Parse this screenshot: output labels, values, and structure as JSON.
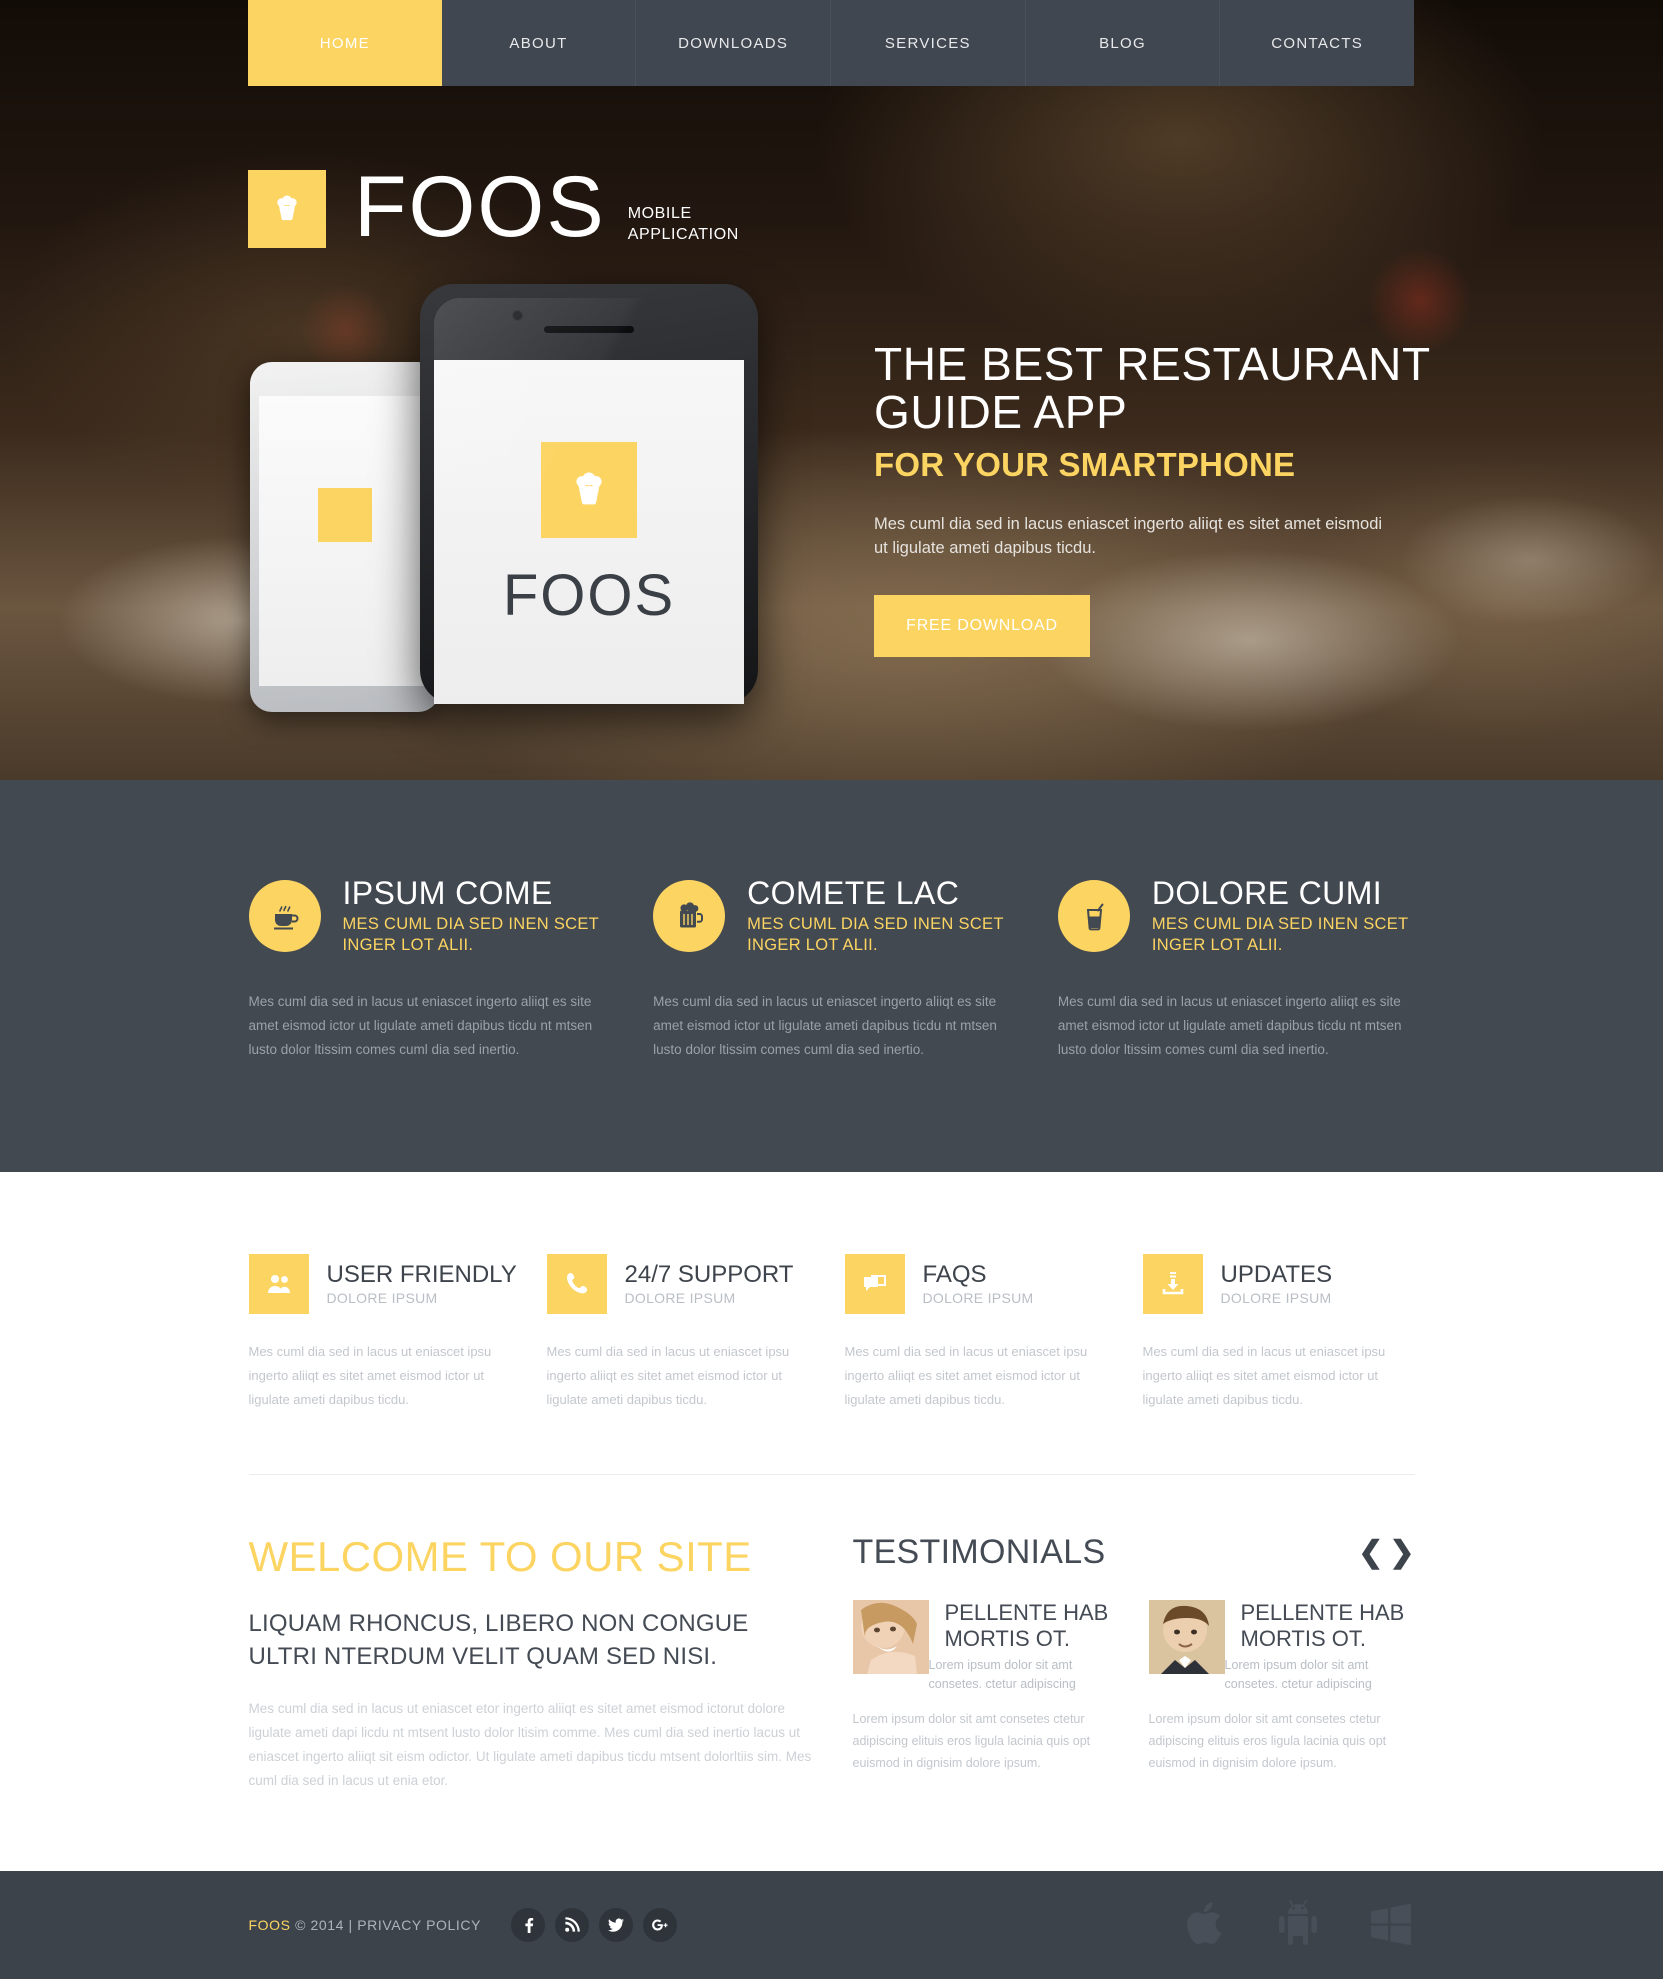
{
  "nav": {
    "items": [
      {
        "label": "HOME",
        "active": true
      },
      {
        "label": "ABOUT",
        "active": false
      },
      {
        "label": "DOWNLOADS",
        "active": false
      },
      {
        "label": "SERVICES",
        "active": false
      },
      {
        "label": "BLOG",
        "active": false
      },
      {
        "label": "CONTACTS",
        "active": false
      }
    ]
  },
  "logo": {
    "name": "FOOS",
    "tagline_line1": "MOBILE",
    "tagline_line2": "APPLICATION",
    "icon": "cupcake-icon"
  },
  "hero": {
    "heading": "THE BEST RESTAURANT GUIDE APP",
    "subheading": "FOR YOUR SMARTPHONE",
    "paragraph": "Mes cuml dia sed in lacus eniascet ingerto aliiqt es sitet amet eismodi ut ligulate ameti dapibus ticdu.",
    "button_label": "FREE DOWNLOAD",
    "phone_screen_word": "FOOS"
  },
  "features": [
    {
      "icon": "coffee-cup-icon",
      "title": "IPSUM COME",
      "subtitle": "MES CUML DIA SED INEN SCET INGER LOT ALII.",
      "body": "Mes cuml dia sed in lacus ut eniascet ingerto aliiqt es site amet eismod ictor ut ligulate ameti dapibus ticdu nt mtsen lusto dolor ltissim comes cuml dia sed inertio."
    },
    {
      "icon": "beer-mug-icon",
      "title": "COMETE LAC",
      "subtitle": "MES CUML DIA SED INEN SCET INGER LOT ALII.",
      "body": "Mes cuml dia sed in lacus ut eniascet ingerto aliiqt es site amet eismod ictor ut ligulate ameti dapibus ticdu nt mtsen lusto dolor ltissim comes cuml dia sed inertio."
    },
    {
      "icon": "drink-glass-icon",
      "title": "DOLORE CUMI",
      "subtitle": "MES CUML DIA SED INEN SCET INGER LOT ALII.",
      "body": "Mes cuml dia sed in lacus ut eniascet ingerto aliiqt es site amet eismod ictor ut ligulate ameti dapibus ticdu nt mtsen lusto dolor ltissim comes cuml dia sed inertio."
    }
  ],
  "services": [
    {
      "icon": "users-icon",
      "title": "USER FRIENDLY",
      "subtitle": "DOLORE IPSUM",
      "body": "Mes cuml dia sed in lacus ut eniascet ipsu ingerto aliiqt es sitet amet eismod ictor ut ligulate ameti dapibus ticdu."
    },
    {
      "icon": "phone-icon",
      "title": "24/7 SUPPORT",
      "subtitle": "DOLORE IPSUM",
      "body": "Mes cuml dia sed in lacus ut eniascet ipsu ingerto aliiqt es sitet amet eismod ictor ut ligulate ameti dapibus ticdu."
    },
    {
      "icon": "chat-bubbles-icon",
      "title": "FAQS",
      "subtitle": "DOLORE IPSUM",
      "body": "Mes cuml dia sed in lacus ut eniascet ipsu ingerto aliiqt es sitet amet eismod ictor ut ligulate ameti dapibus ticdu."
    },
    {
      "icon": "download-tray-icon",
      "title": "UPDATES",
      "subtitle": "DOLORE IPSUM",
      "body": "Mes cuml dia sed in lacus ut eniascet ipsu ingerto aliiqt es sitet amet eismod ictor ut ligulate ameti dapibus ticdu."
    }
  ],
  "welcome": {
    "heading": "WELCOME TO OUR SITE",
    "subheading": "LIQUAM RHONCUS, LIBERO NON CONGUE ULTRI NTERDUM VELIT QUAM SED NISI.",
    "paragraph": "Mes cuml dia sed in lacus ut eniascet etor ingerto aliiqt es sitet amet eismod ictorut dolore ligulate ameti dapi licdu nt mtsent lusto dolor ltisim comme. Mes cuml dia sed inertio lacus ut eniascet ingerto aliiqt sit eism odictor. Ut ligulate ameti dapibus ticdu mtsent dolorltiis sim. Mes cuml dia sed in lacus ut enia etor."
  },
  "testimonials": {
    "heading": "TESTIMONIALS",
    "prev_icon": "chevron-left-icon",
    "next_icon": "chevron-right-icon",
    "items": [
      {
        "avatar": "woman-smiling-avatar",
        "name": "PELLENTE HAB MORTIS OT.",
        "quote_short": "Lorem ipsum dolor sit amt consetes. ctetur adipiscing",
        "quote_long": "Lorem ipsum dolor sit amt consetes ctetur adipiscing elituis eros ligula lacinia quis opt euismod in dignisim dolore ipsum."
      },
      {
        "avatar": "man-suit-avatar",
        "name": "PELLENTE HAB MORTIS OT.",
        "quote_short": "Lorem ipsum dolor sit amt consetes. ctetur adipiscing",
        "quote_long": "Lorem ipsum dolor sit amt consetes ctetur adipiscing elituis eros ligula lacinia quis opt euismod in dignisim dolore ipsum."
      }
    ]
  },
  "footer": {
    "brand": "FOOS",
    "copyright": " © 2014  |  PRIVACY POLICY",
    "social": [
      {
        "name": "facebook-icon",
        "glyph": "f"
      },
      {
        "name": "rss-icon",
        "glyph": ""
      },
      {
        "name": "twitter-icon",
        "glyph": ""
      },
      {
        "name": "google-plus-icon",
        "glyph": "g+"
      }
    ],
    "platforms": [
      "apple-icon",
      "android-icon",
      "windows-icon"
    ]
  },
  "colors": {
    "accent": "#fcd462",
    "dark": "#434950",
    "footer": "#3d434b",
    "text_dark": "#454b54"
  }
}
